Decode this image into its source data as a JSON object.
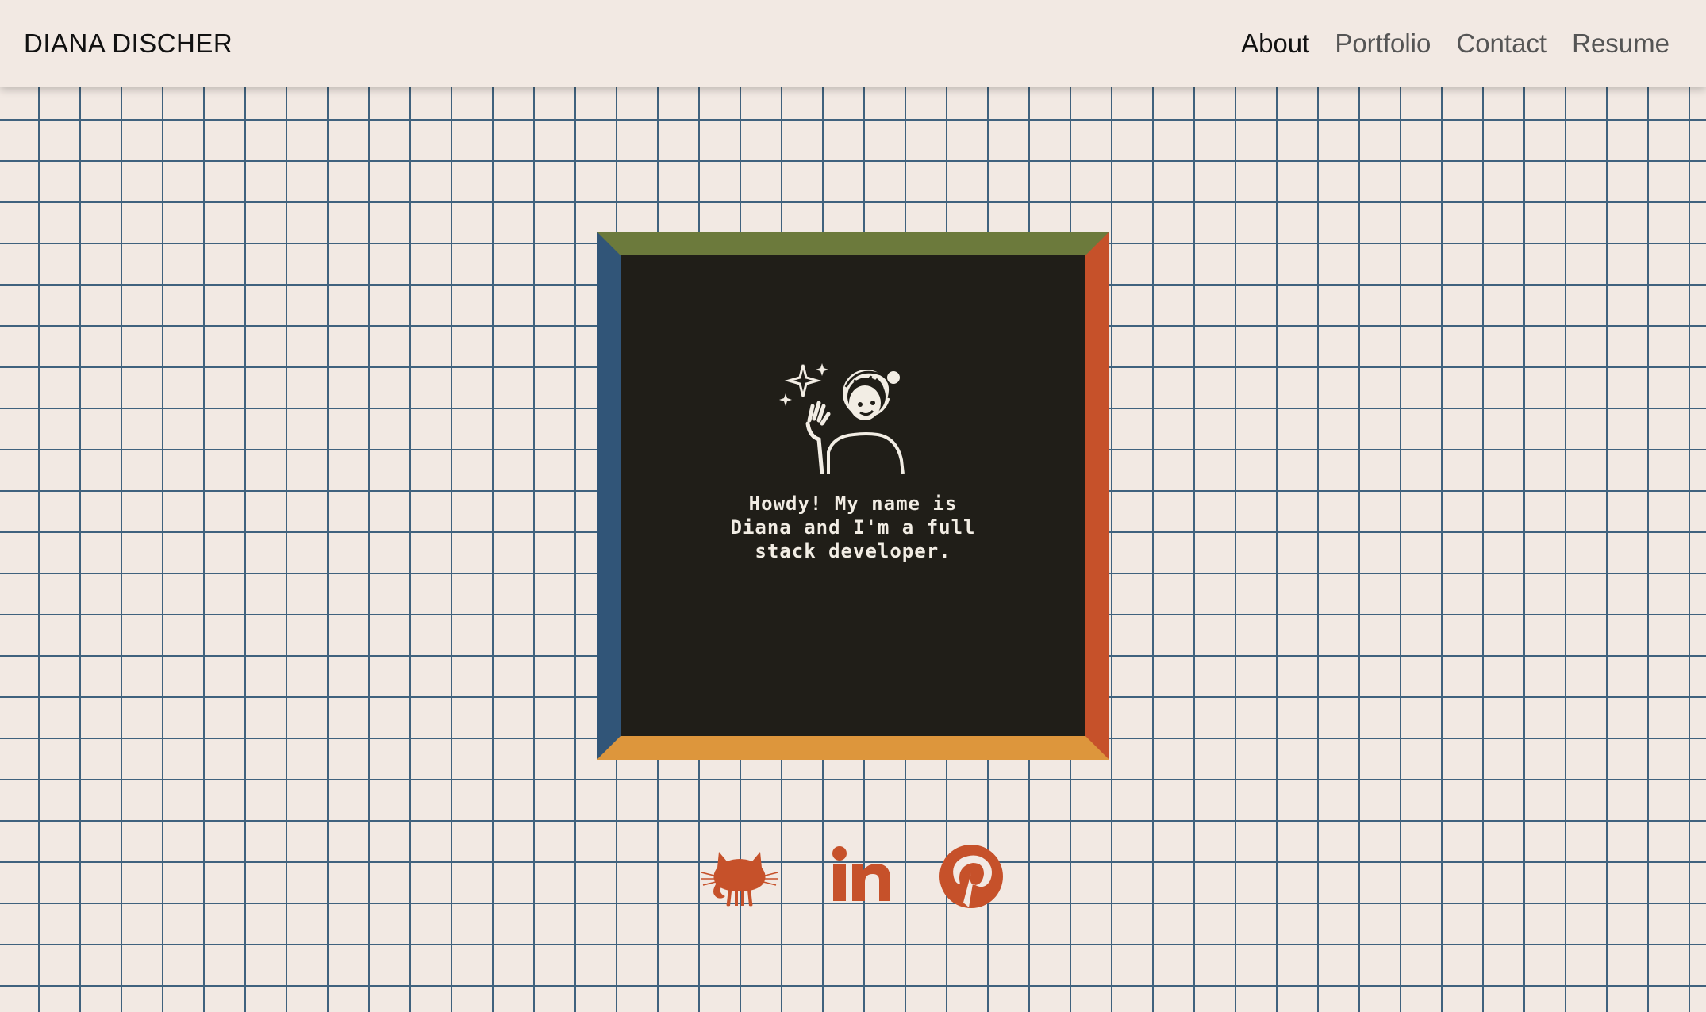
{
  "header": {
    "brand": "DIANA DISCHER",
    "nav": [
      {
        "label": "About",
        "active": true
      },
      {
        "label": "Portfolio",
        "active": false
      },
      {
        "label": "Contact",
        "active": false
      },
      {
        "label": "Resume",
        "active": false
      }
    ]
  },
  "hero": {
    "intro": "Howdy! My name is Diana and I'm a full stack developer."
  },
  "social": {
    "items": [
      {
        "name": "github",
        "icon": "github-icon"
      },
      {
        "name": "linkedin",
        "icon": "linkedin-icon"
      },
      {
        "name": "pinterest",
        "icon": "pinterest-icon"
      }
    ]
  },
  "colors": {
    "background": "#f2e9e3",
    "grid": "#40627e",
    "frame_top": "#6c7a3c",
    "frame_right": "#c6512a",
    "frame_bottom": "#dd963c",
    "frame_left": "#315578",
    "screen": "#201e18",
    "icon": "#c6512a"
  }
}
